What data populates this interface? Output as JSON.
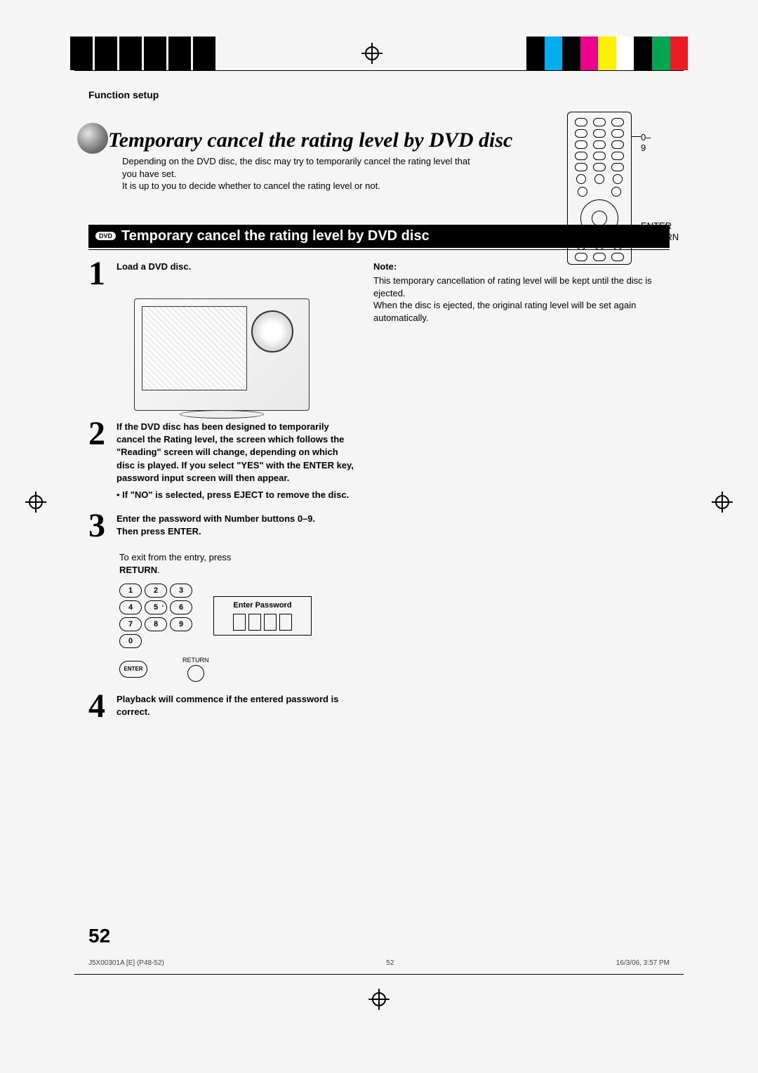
{
  "header": {
    "section": "Function setup"
  },
  "title": "Temporary cancel the rating level by DVD disc",
  "intro": {
    "line1": "Depending on the DVD disc, the disc may try to temporarily cancel the rating level that you have set.",
    "line2": "It is up to you to decide whether to cancel the rating level or not."
  },
  "remote_labels": {
    "numbers": "0–9",
    "enter": "ENTER",
    "return": "RETURN"
  },
  "banner": {
    "badge": "DVD",
    "text": "Temporary cancel the rating level by DVD disc"
  },
  "steps": {
    "s1": {
      "n": "1",
      "text": "Load a DVD disc."
    },
    "s2": {
      "n": "2",
      "text": "If the DVD disc has been designed to temporarily cancel the Rating level, the screen which follows the \"Reading\" screen will change, depending on which disc is played. If you select \"YES\" with the ENTER key, password input screen will then appear.",
      "bullet": "If \"NO\" is selected, press EJECT to remove the disc."
    },
    "s3": {
      "n": "3",
      "line1": "Enter the password with Number buttons 0–9.",
      "line2": "Then press ENTER.",
      "hint_pre": "To exit from the entry, press ",
      "hint_key": "RETURN",
      "hint_post": "."
    },
    "s4": {
      "n": "4",
      "text": "Playback will commence if the entered password is correct."
    }
  },
  "keypad": {
    "buttons": [
      "1",
      "2",
      "3",
      "4",
      "5",
      "6",
      "7",
      "8",
      "9",
      "0"
    ],
    "enter": "ENTER",
    "return": "RETURN"
  },
  "password_box": {
    "title": "Enter Password"
  },
  "note": {
    "heading": "Note:",
    "l1": "This temporary cancellation of rating level will be kept until the disc is ejected.",
    "l2": "When the disc is ejected, the original rating level will be set again automatically."
  },
  "page_number": "52",
  "footer": {
    "left": "J5X00301A [E] (P48-52)",
    "center": "52",
    "right": "16/3/06, 3:57 PM"
  }
}
